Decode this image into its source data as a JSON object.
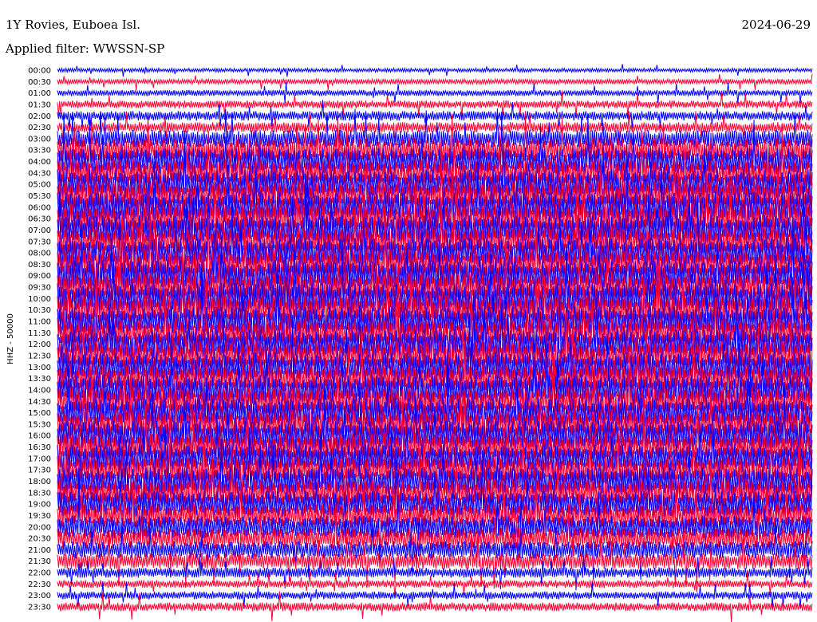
{
  "chart_data": {
    "type": "line",
    "title_left": "1Y Rovies, Euboea Isl.",
    "title_right": "2024-06-29",
    "subtitle": "Applied filter: WWSSN-SP",
    "ylabel": "HHZ - 50000",
    "row_labels": [
      "00:00",
      "00:30",
      "01:00",
      "01:30",
      "02:00",
      "02:30",
      "03:00",
      "03:30",
      "04:00",
      "04:30",
      "05:00",
      "05:30",
      "06:00",
      "06:30",
      "07:00",
      "07:30",
      "08:00",
      "08:30",
      "09:00",
      "09:30",
      "10:00",
      "10:30",
      "11:00",
      "11:30",
      "12:00",
      "12:30",
      "13:00",
      "13:30",
      "14:00",
      "14:30",
      "15:00",
      "15:30",
      "16:00",
      "16:30",
      "17:00",
      "17:30",
      "18:00",
      "18:30",
      "19:00",
      "19:30",
      "20:00",
      "20:30",
      "21:00",
      "21:30",
      "22:00",
      "22:30",
      "23:00",
      "23:30"
    ],
    "trace_colors": [
      "#0000ff",
      "#ff0033"
    ],
    "row_amplitude": [
      0.22,
      0.3,
      0.35,
      0.45,
      0.55,
      0.6,
      1.0,
      1.4,
      1.6,
      1.6,
      1.7,
      1.8,
      1.8,
      1.8,
      1.7,
      1.7,
      1.7,
      1.8,
      1.8,
      1.8,
      1.8,
      1.8,
      1.7,
      1.7,
      1.7,
      1.7,
      1.7,
      1.7,
      1.7,
      1.7,
      1.7,
      1.7,
      1.7,
      1.7,
      1.6,
      1.6,
      1.6,
      1.6,
      1.5,
      1.4,
      1.3,
      1.2,
      1.0,
      0.9,
      0.6,
      0.45,
      0.45,
      0.5
    ],
    "legend": "none",
    "grid": false
  }
}
